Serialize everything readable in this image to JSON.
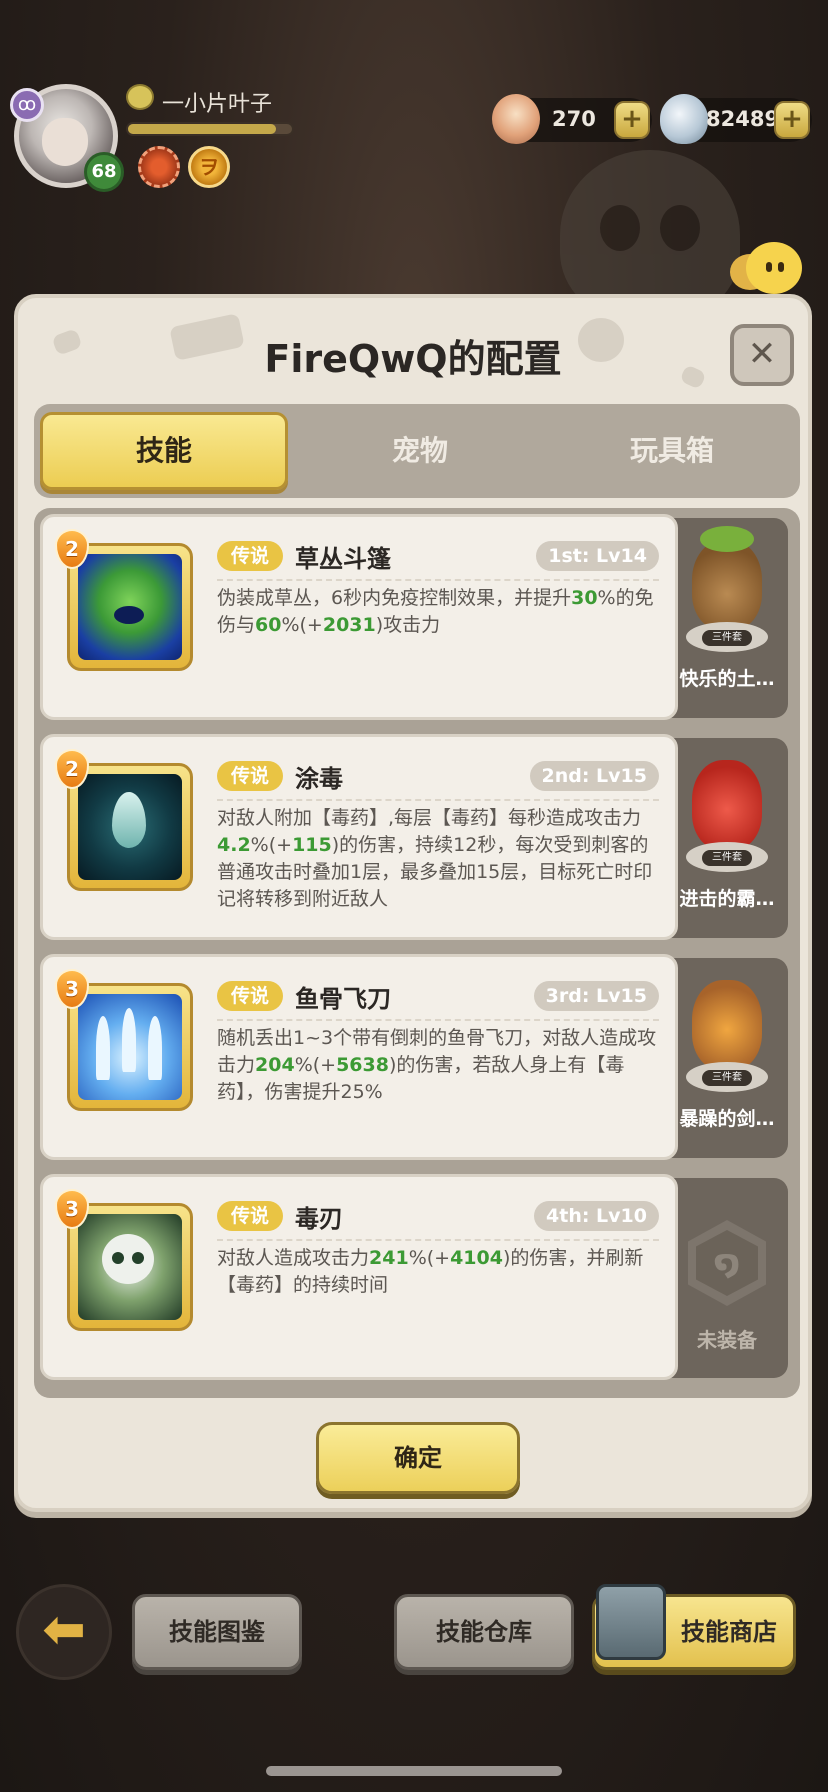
{
  "player": {
    "name": "一小片叶子",
    "level": "68",
    "class_icon": "ribbon-icon",
    "badges": [
      "flower-badge-icon",
      "coin-badge-icon"
    ],
    "xp_fraction": 0.9
  },
  "currencies": [
    {
      "icon": "shell-icon",
      "value": "270",
      "plus": "+"
    },
    {
      "icon": "pearl-icon",
      "value": "82489",
      "plus": "+"
    }
  ],
  "chat": {
    "label": "聊天"
  },
  "modal": {
    "title": "FireQwQ的配置",
    "close": "✕",
    "tabs": [
      {
        "label": "技能",
        "active": true
      },
      {
        "label": "宠物",
        "active": false
      },
      {
        "label": "玩具箱",
        "active": false
      }
    ],
    "skills": [
      {
        "rank": "2",
        "rarity": "传说",
        "name": "草丛斗篷",
        "slot": "1st: Lv14",
        "desc_parts": [
          {
            "t": "伪装成草丛，6秒内免疫控制效果，并提升"
          },
          {
            "t": "30",
            "hl": true
          },
          {
            "t": "%的免伤与"
          },
          {
            "t": "60",
            "hl": true
          },
          {
            "t": "%(+"
          },
          {
            "t": "2031",
            "hl": true
          },
          {
            "t": ")攻击力"
          }
        ],
        "icon": "bush-cloak-icon",
        "pet": {
          "name": "快乐的土…",
          "set": "三件套",
          "icon": "monkey-pet-icon"
        }
      },
      {
        "rank": "2",
        "rarity": "传说",
        "name": "涂毒",
        "slot": "2nd: Lv15",
        "desc_parts": [
          {
            "t": "对敌人附加【毒药】,每层【毒药】每秒造成攻击力"
          },
          {
            "t": "4.2",
            "hl": true
          },
          {
            "t": "%(+"
          },
          {
            "t": "115",
            "hl": true
          },
          {
            "t": ")的伤害，持续12秒，每次受到刺客的普通攻击时叠加1层，最多叠加15层，目标死亡时印记将转移到附近敌人"
          }
        ],
        "icon": "poison-drop-icon",
        "pet": {
          "name": "进击的霸…",
          "set": "三件套",
          "icon": "red-dino-pet-icon"
        }
      },
      {
        "rank": "3",
        "rarity": "传说",
        "name": "鱼骨飞刀",
        "slot": "3rd: Lv15",
        "desc_parts": [
          {
            "t": "随机丢出1~3个带有倒刺的鱼骨飞刀，对敌人造成攻击力"
          },
          {
            "t": "204",
            "hl": true
          },
          {
            "t": "%(+"
          },
          {
            "t": "5638",
            "hl": true
          },
          {
            "t": ")的伤害，若敌人身上有【毒药】，伤害提升25%"
          }
        ],
        "icon": "fishbone-blades-icon",
        "pet": {
          "name": "暴躁的剑…",
          "set": "三件套",
          "icon": "tiger-pet-icon"
        }
      },
      {
        "rank": "3",
        "rarity": "传说",
        "name": "毒刃",
        "slot": "4th: Lv10",
        "desc_parts": [
          {
            "t": "对敌人造成攻击力"
          },
          {
            "t": "241",
            "hl": true
          },
          {
            "t": "%(+"
          },
          {
            "t": "4104",
            "hl": true
          },
          {
            "t": ")的伤害，并刷新【毒药】的持续时间"
          }
        ],
        "icon": "poison-skull-icon",
        "pet": {
          "empty": true,
          "empty_label": "未装备",
          "icon": "empty-slot-hex-icon"
        }
      }
    ],
    "confirm": "确定"
  },
  "bottom": {
    "back_icon": "back-arrow-icon",
    "buttons": [
      "技能图鉴",
      "技能仓库",
      "技能商店"
    ],
    "shop_icon": "stone-tablet-icon"
  }
}
